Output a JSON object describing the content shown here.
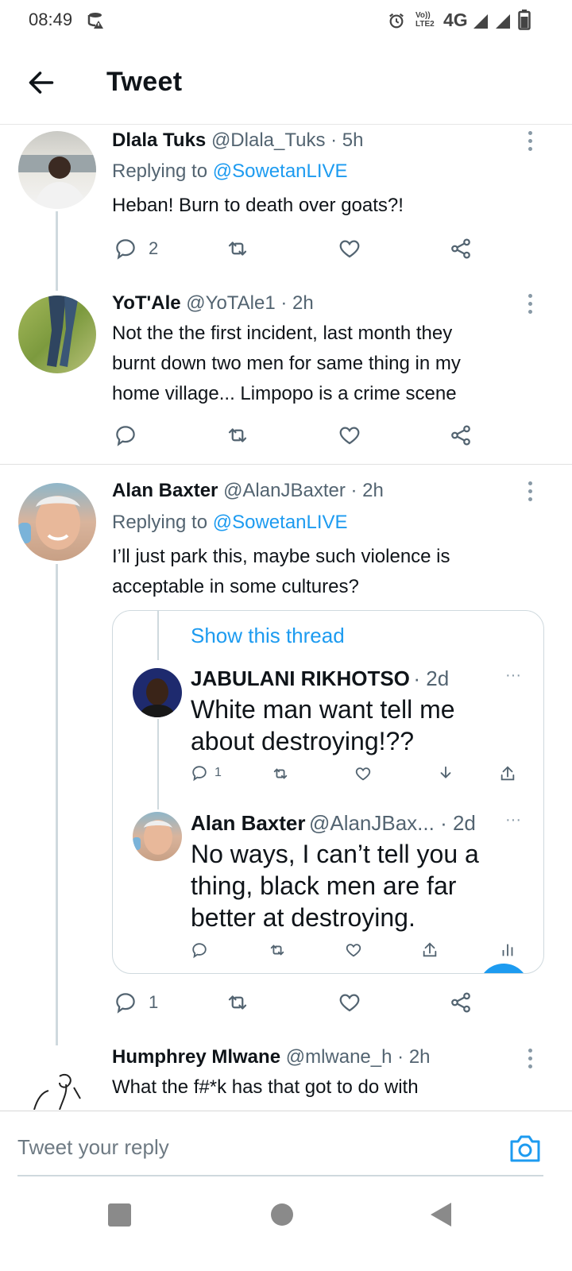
{
  "status_bar": {
    "time": "08:49",
    "network": "4G",
    "volte": "Vo)) LTE2"
  },
  "header": {
    "title": "Tweet"
  },
  "tweets": [
    {
      "name": "Dlala Tuks",
      "handle": "@Dlala_Tuks",
      "time": "· 5h",
      "replying_prefix": "Replying to ",
      "replying_to": "@SowetanLIVE",
      "body": "Heban! Burn to death over goats?!",
      "reply_count": "2"
    },
    {
      "name": "YoT'Ale",
      "handle": "@YoTAle1",
      "time": "· 2h",
      "body_lines": [
        "Not the the first incident, last month they",
        "burnt down two men for same thing in my",
        "home village... Limpopo is a crime scene"
      ]
    },
    {
      "name": "Alan Baxter",
      "handle": "@AlanJBaxter",
      "time": "· 2h",
      "replying_prefix": "Replying to ",
      "replying_to": "@SowetanLIVE",
      "body_lines": [
        "I’ll just park this, maybe such violence is",
        "acceptable in some cultures?"
      ],
      "reply_count": "1",
      "embedded": {
        "show_thread": "Show this thread",
        "items": [
          {
            "name": "JABULANI RIKHOTSO",
            "meta": "· 2d",
            "body_lines": [
              "White man want tell me",
              "about destroying!??"
            ],
            "reply_count": "1"
          },
          {
            "name": "Alan Baxter",
            "meta": "@AlanJBax... · 2d",
            "body_lines": [
              "No ways, I can’t tell you a",
              "thing, black men are far",
              "better at destroying."
            ]
          }
        ]
      }
    },
    {
      "name": "Humphrey Mlwane",
      "handle": "@mlwane_h",
      "time": "· 2h",
      "body": "What the f#*k has that got to do with"
    }
  ],
  "reply_bar": {
    "placeholder": "Tweet your reply"
  },
  "colors": {
    "link": "#1d9bf0",
    "muted": "#536471",
    "text": "#0f1419"
  }
}
